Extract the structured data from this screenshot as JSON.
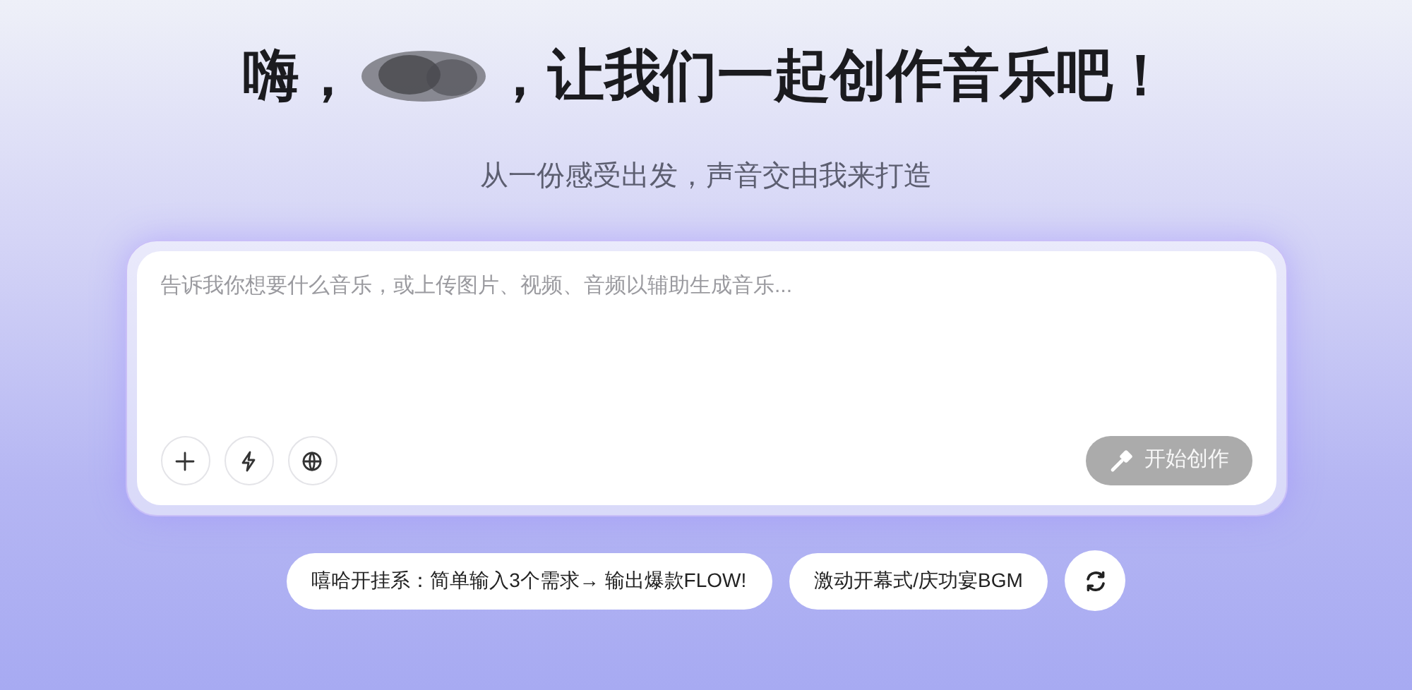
{
  "heading": {
    "before": "嗨，",
    "after": "，让我们一起创作音乐吧！"
  },
  "subtitle": "从一份感受出发，声音交由我来打造",
  "prompt": {
    "placeholder": "告诉我你想要什么音乐，或上传图片、视频、音频以辅助生成音乐..."
  },
  "tools": [
    {
      "kind": "add"
    },
    {
      "kind": "bolt"
    },
    {
      "kind": "globe"
    }
  ],
  "submit": {
    "label": "开始创作",
    "disabled": true
  },
  "suggestions": [
    {
      "label": "嘻哈开挂系：简单输入3个需求→ 输出爆款FLOW!"
    },
    {
      "label": "激动开幕式/庆功宴BGM"
    }
  ]
}
